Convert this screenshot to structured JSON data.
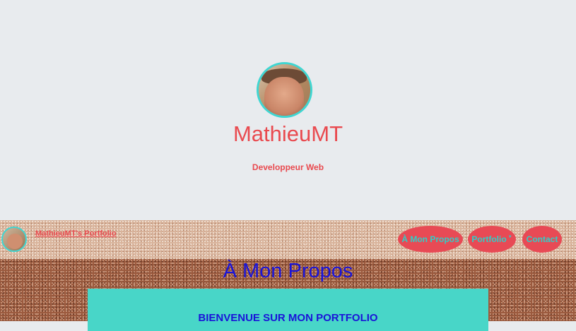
{
  "hero": {
    "name": "MathieuMT",
    "subtitle": "Developpeur Web"
  },
  "navbar": {
    "brand": "MathieuMT's Portfolio",
    "items": [
      {
        "label": "À Mon Propos"
      },
      {
        "label": "Portfolio"
      },
      {
        "label": "Contact"
      }
    ]
  },
  "main": {
    "section_title": "À Mon Propos",
    "welcome_text": "BIENVENUE SUR MON PORTFOLIO"
  },
  "colors": {
    "accent_red": "#e94a4f",
    "accent_teal": "#3fd6d2",
    "heading_blue": "#1a14d8"
  }
}
